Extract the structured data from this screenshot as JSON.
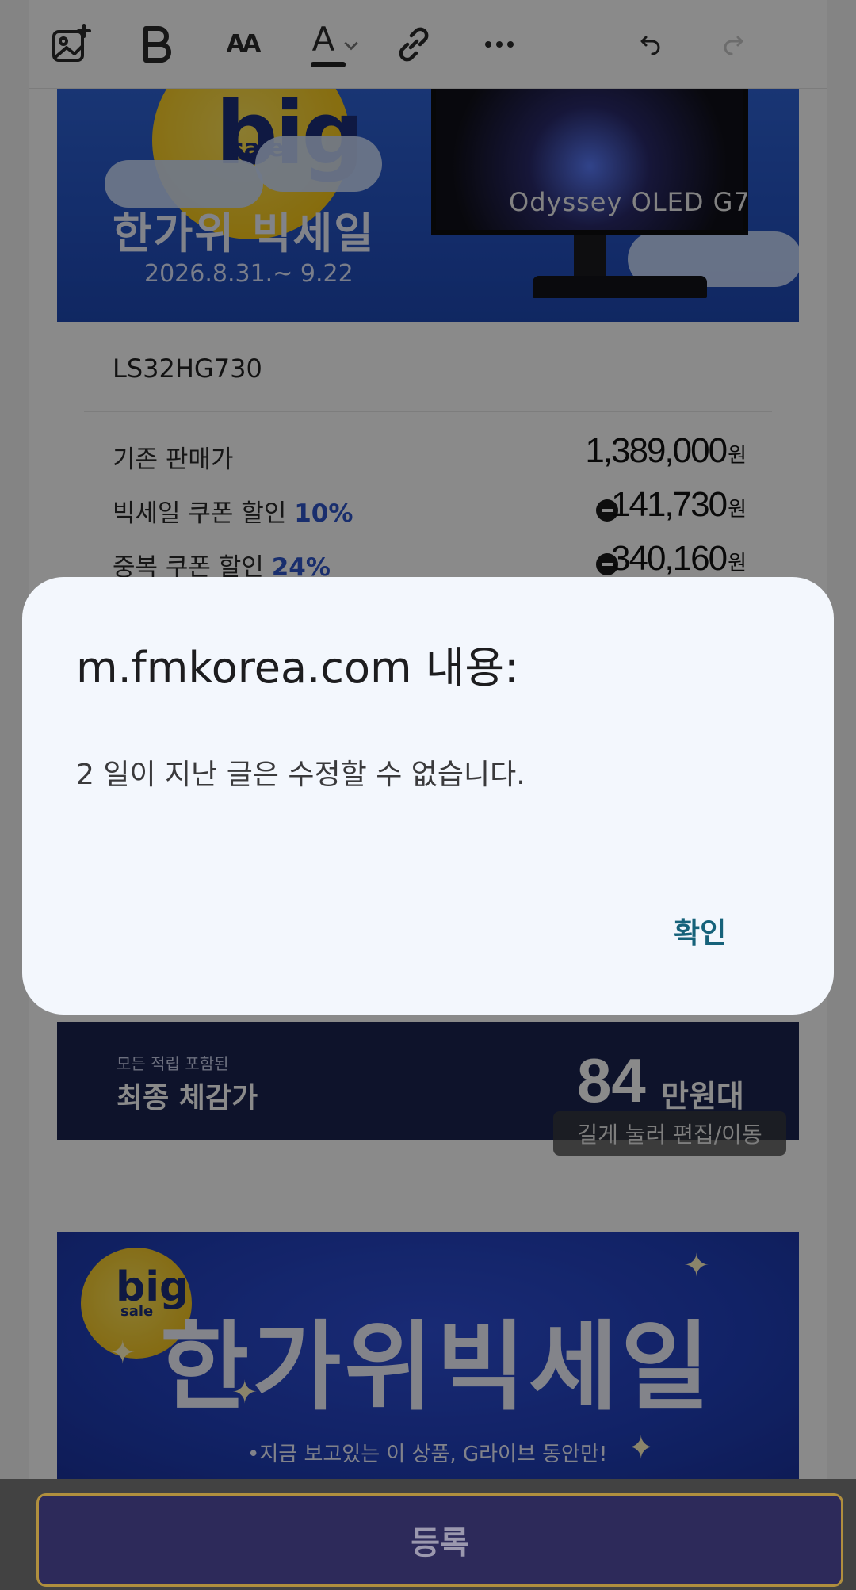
{
  "toolbar": {
    "icons": [
      "add-image-icon",
      "bold-icon",
      "font-size-icon",
      "text-color-icon",
      "link-icon",
      "more-icon",
      "undo-icon",
      "redo-icon"
    ],
    "font_size_glyph": "AA",
    "text_color_glyph": "A",
    "text_color_underline": "#222222"
  },
  "banner1": {
    "big": "big",
    "sale": "sale",
    "title": "한가위 빅세일",
    "date": "2026.8.31.~ 9.22",
    "product_label": "Odyssey OLED G7"
  },
  "price_card": {
    "model": "LS32HG730",
    "rows": [
      {
        "label": "기존 판매가",
        "percent": "",
        "amount": "1,389,000",
        "unit": "원",
        "minus": false
      },
      {
        "label": "빅세일 쿠폰 할인 ",
        "percent": "10%",
        "amount": "141,730",
        "unit": "원",
        "minus": true
      },
      {
        "label": "중복 쿠폰 할인 ",
        "percent": "24%",
        "amount": "340,160",
        "unit": "원",
        "minus": true
      }
    ]
  },
  "final_band": {
    "small": "모든 적립 포함된",
    "title": "최종 체감가",
    "number": "84",
    "unit": "만원대"
  },
  "hint": "길게 눌러 편집/이동",
  "banner2": {
    "big": "big",
    "sale": "sale",
    "title": "한가위빅세일",
    "subtitle": "•지금 보고있는 이 상품, G라이브 동안만!"
  },
  "dialog": {
    "title": "m.fmkorea.com 내용:",
    "message": "2 일이 지난 글은 수정할 수 없습니다.",
    "ok_label": "확인"
  },
  "register_button": "등록",
  "colors": {
    "dialog_bg": "#f3f7fd",
    "ok_text": "#16627a",
    "register_bg": "#2d2a5a",
    "register_border": "#b08f3e"
  }
}
